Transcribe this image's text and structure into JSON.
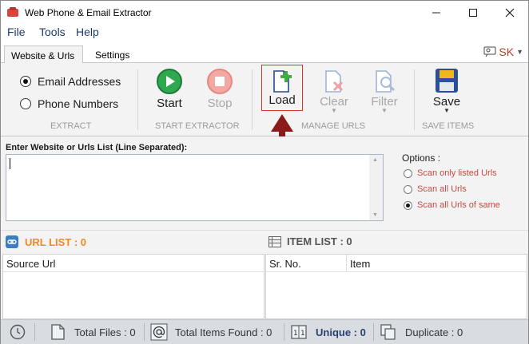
{
  "window": {
    "title": "Web Phone & Email Extractor"
  },
  "menu": [
    "File",
    "Tools",
    "Help"
  ],
  "tabs": {
    "active": "Website & Urls",
    "settings": "Settings",
    "user_badge": "SK"
  },
  "ribbon": {
    "extract": {
      "options": [
        {
          "label": "Email Addresses",
          "checked": true
        },
        {
          "label": "Phone Numbers",
          "checked": false
        }
      ],
      "group_label": "EXTRACT"
    },
    "start_extractor": {
      "start_label": "Start",
      "stop_label": "Stop",
      "group_label": "START EXTRACTOR"
    },
    "manage_urls": {
      "load_label": "Load",
      "clear_label": "Clear",
      "filter_label": "Filter",
      "group_label": "MANAGE URLS"
    },
    "save_items": {
      "save_label": "Save",
      "group_label": "SAVE ITEMS"
    }
  },
  "input": {
    "label": "Enter Website or Urls List (Line Separated):",
    "value": ""
  },
  "options": {
    "title": "Options :",
    "items": [
      {
        "label": "Scan only listed Urls",
        "checked": false
      },
      {
        "label": "Scan all Urls",
        "checked": false
      },
      {
        "label": "Scan all Urls of same",
        "checked": true
      }
    ]
  },
  "url_list": {
    "title": "URL LIST : 0",
    "column": "Source Url"
  },
  "item_list": {
    "title": "ITEM LIST : 0",
    "columns": [
      "Sr. No.",
      "Item"
    ]
  },
  "status": {
    "total_files": "Total Files : 0",
    "total_items": "Total Items Found : 0",
    "unique": "Unique : 0",
    "duplicate": "Duplicate : 0"
  },
  "colors": {
    "accent_orange": "#f08a1c",
    "option_red": "#c94a3f",
    "highlight_red": "#d9302a",
    "arrow_red": "#8b1a1a"
  }
}
